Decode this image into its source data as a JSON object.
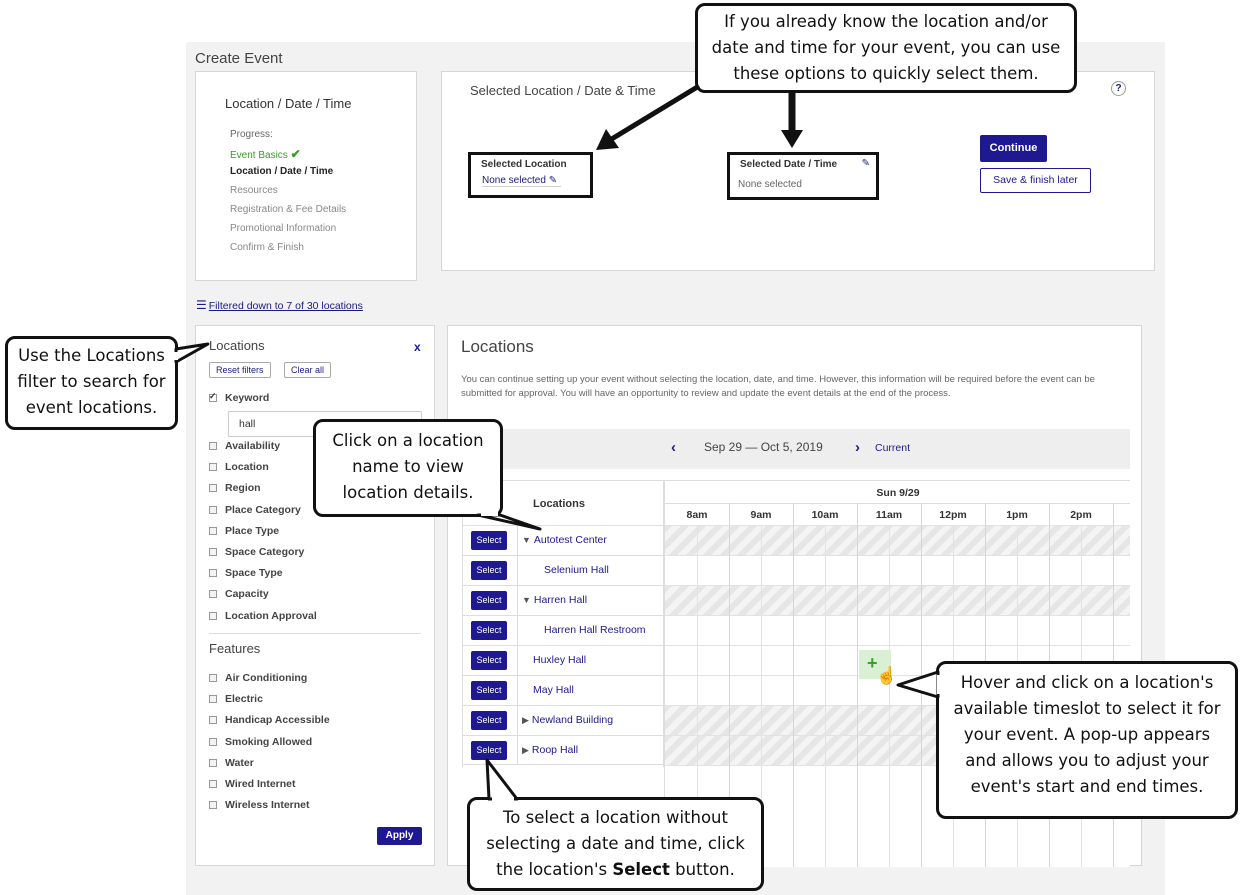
{
  "page": {
    "title": "Create Event"
  },
  "progress": {
    "title": "Location / Date / Time",
    "label": "Progress:",
    "steps": [
      {
        "label": "Event Basics",
        "state": "done"
      },
      {
        "label": "Location / Date / Time",
        "state": "current"
      },
      {
        "label": "Resources",
        "state": "pending"
      },
      {
        "label": "Registration & Fee Details",
        "state": "pending"
      },
      {
        "label": "Promotional Information",
        "state": "pending"
      },
      {
        "label": "Confirm & Finish",
        "state": "pending"
      }
    ]
  },
  "selected": {
    "title": "Selected Location / Date & Time",
    "help": "?",
    "location_title": "Selected Location",
    "location_value": "None selected",
    "datetime_title": "Selected Date / Time",
    "datetime_value": "None selected",
    "continue_label": "Continue",
    "save_later_label": "Save & finish later"
  },
  "filter_link": "Filtered down to 7 of 30 locations",
  "filters": {
    "title": "Locations",
    "close": "x",
    "reset_label": "Reset filters",
    "clear_label": "Clear all",
    "keyword_label": "Keyword",
    "keyword_value": "hall",
    "location_filters": [
      "Availability",
      "Location",
      "Region",
      "Place Category",
      "Place Type",
      "Space Category",
      "Space Type",
      "Capacity",
      "Location Approval"
    ],
    "features_title": "Features",
    "features": [
      "Air Conditioning",
      "Electric",
      "Handicap Accessible",
      "Smoking Allowed",
      "Water",
      "Wired Internet",
      "Wireless Internet"
    ],
    "apply_label": "Apply"
  },
  "locations": {
    "title": "Locations",
    "description": "You can continue setting up your event without selecting the location, date, and time. However, this information will be required before the event can be submitted for approval. You will have an opportunity to review and update the event details at the end of the process.",
    "nav": {
      "range": "Sep 29 — Oct 5, 2019",
      "current": "Current",
      "prev": "‹",
      "next": "›"
    },
    "column_header": "Locations",
    "select_label": "Select",
    "day": "Sun 9/29",
    "hours": [
      "8am",
      "9am",
      "10am",
      "11am",
      "12pm",
      "1pm",
      "2pm"
    ],
    "rows": [
      {
        "name": "Autotest Center",
        "expander": "▼"
      },
      {
        "name": "Selenium Hall",
        "expander": ""
      },
      {
        "name": "Harren Hall",
        "expander": "▼"
      },
      {
        "name": "Harren Hall Restroom",
        "expander": ""
      },
      {
        "name": "Huxley Hall",
        "expander": ""
      },
      {
        "name": "May Hall",
        "expander": ""
      },
      {
        "name": "Newland Building",
        "expander": "▶"
      },
      {
        "name": "Roop Hall",
        "expander": "▶"
      }
    ]
  },
  "callouts": {
    "top": "If you already know the location and/or date and time for your event, you can use these options to quickly select them.",
    "filter": "Use the Locations filter to search for event locations.",
    "name": "Click on a location name to view location details.",
    "hover": "Hover and click on a location's available timeslot to select it for your event.  A pop-up appears and allows you to adjust your event's start and end times.",
    "select_pre": "To select a location without selecting a date and time, click the location's ",
    "select_bold": "Select",
    "select_post": " button."
  }
}
